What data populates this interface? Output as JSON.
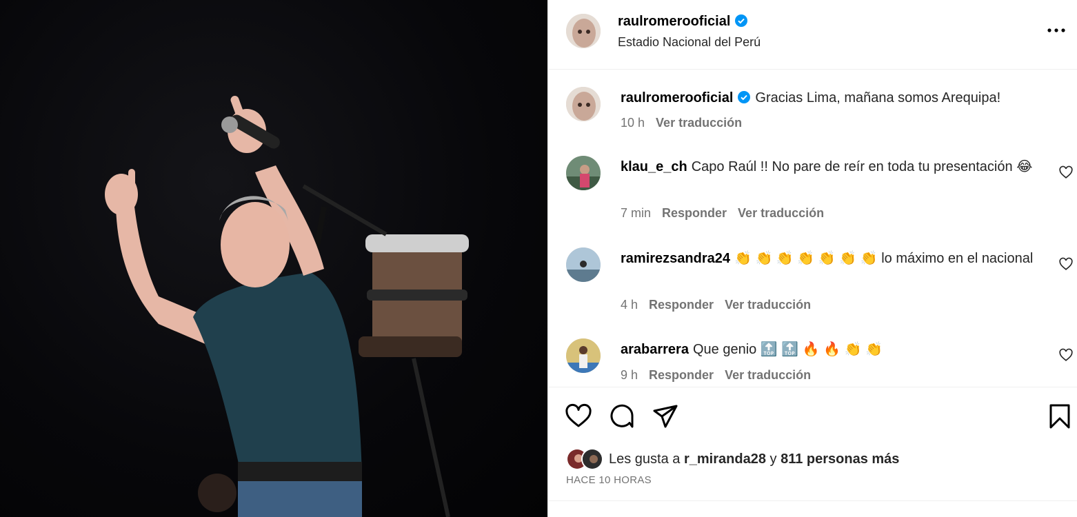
{
  "post": {
    "author": "raulromerooficial",
    "location": "Estadio Nacional del Perú",
    "caption": "Gracias Lima, mañana somos Arequipa!",
    "caption_time": "10 h",
    "see_translation": "Ver traducción"
  },
  "comments": [
    {
      "user": "klau_e_ch",
      "text": "Capo Raúl !! No pare de reír en toda tu presentación 😂",
      "time": "7 min",
      "reply": "Responder",
      "translate": "Ver traducción"
    },
    {
      "user": "ramirezsandra24",
      "text": "👏 👏 👏 👏 👏 👏 👏  lo máximo en el nacional",
      "time": "4 h",
      "reply": "Responder",
      "translate": "Ver traducción"
    },
    {
      "user": "arabarrera",
      "text": "Que genio 🔝 🔝 🔥 🔥 👏 👏",
      "time": "9 h",
      "reply": "Responder",
      "translate": "Ver traducción"
    }
  ],
  "likes": {
    "prefix": "Les gusta a",
    "user": "r_miranda28",
    "joiner": "y",
    "others": "811 personas más"
  },
  "time_ago": "HACE 10 HORAS",
  "icons": {
    "verified": "verified-badge-icon",
    "more": "more-options-icon",
    "like": "heart-icon",
    "comment": "comment-icon",
    "share": "share-icon",
    "save": "bookmark-icon"
  },
  "colors": {
    "verified": "#0095f6",
    "secondary_text": "#737373",
    "divider": "#efefef"
  }
}
